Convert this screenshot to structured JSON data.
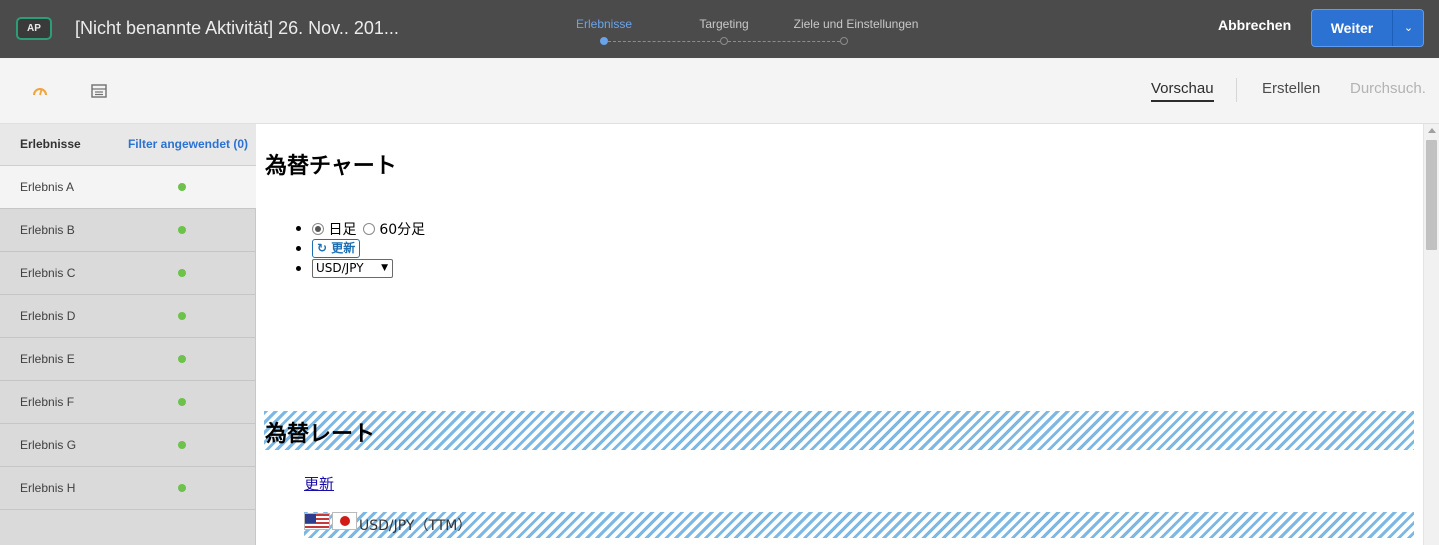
{
  "header": {
    "badge": "AP",
    "activity_title": "[Nicht benannte Aktivität] 26. Nov.. 201...",
    "steps": [
      {
        "label": "Erlebnisse",
        "active": true
      },
      {
        "label": "Targeting",
        "active": false
      },
      {
        "label": "Ziele und Einstellungen",
        "active": false
      }
    ],
    "cancel_label": "Abbrechen",
    "next_label": "Weiter",
    "accent_color": "#2c72d2"
  },
  "toolbar": {
    "icons": [
      "gauge-icon",
      "layout-icon"
    ],
    "tabs": [
      {
        "label": "Vorschau",
        "state": "active"
      },
      {
        "label": "Erstellen",
        "state": "normal"
      },
      {
        "label": "Durchsuch.",
        "state": "disabled"
      }
    ]
  },
  "sidebar": {
    "title": "Erlebnisse",
    "filter_label": "Filter angewendet (0)",
    "items": [
      {
        "label": "Erlebnis A",
        "selected": true
      },
      {
        "label": "Erlebnis B",
        "selected": false
      },
      {
        "label": "Erlebnis C",
        "selected": false
      },
      {
        "label": "Erlebnis D",
        "selected": false
      },
      {
        "label": "Erlebnis E",
        "selected": false
      },
      {
        "label": "Erlebnis F",
        "selected": false
      },
      {
        "label": "Erlebnis G",
        "selected": false
      },
      {
        "label": "Erlebnis H",
        "selected": false
      }
    ],
    "status_color": "#6cc24a"
  },
  "preview": {
    "chart_heading": "為替チャート",
    "radio_daily": "日足",
    "radio_60min": "60分足",
    "refresh_button": "更新",
    "pair_select": "USD/JPY",
    "rate_heading": "為替レート",
    "update_link": "更新",
    "pair_label": "USD/JPY（TTM）"
  }
}
